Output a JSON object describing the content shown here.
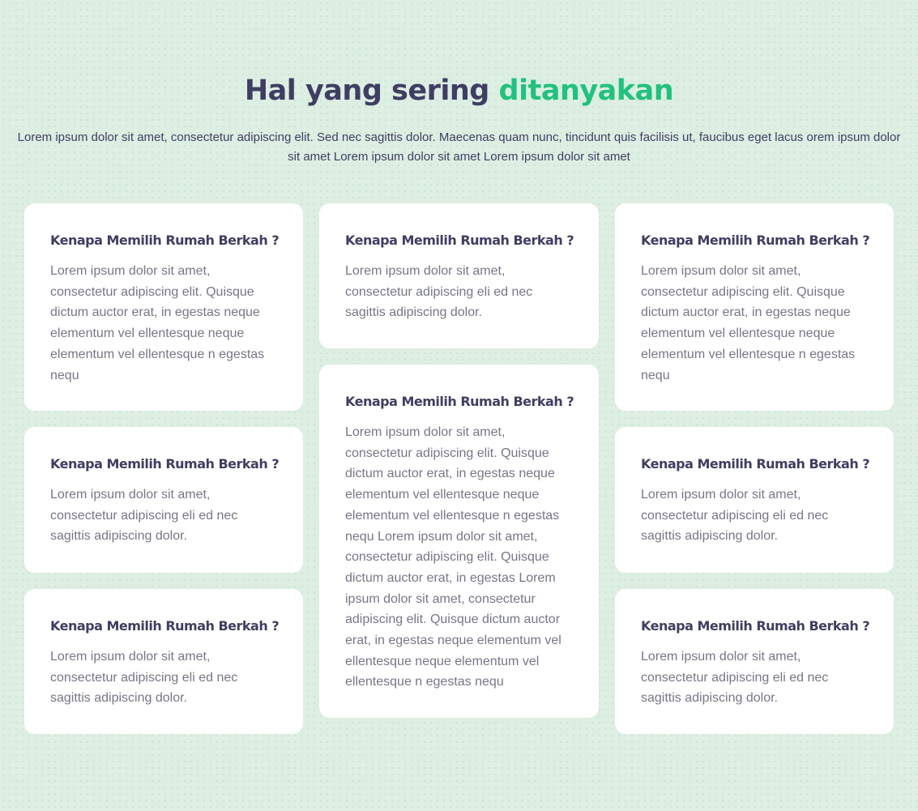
{
  "header": {
    "title_main": "Hal yang sering",
    "title_accent": "ditanyakan",
    "description": "Lorem ipsum dolor sit amet, consectetur adipiscing elit. Sed nec sagittis dolor. Maecenas quam nunc, tincidunt quis facilisis ut, faucibus eget lacus orem ipsum dolor sit amet Lorem ipsum dolor sit amet Lorem ipsum dolor sit amet"
  },
  "faq": [
    {
      "question": "Kenapa Memilih Rumah Berkah ?",
      "answer": "Lorem ipsum dolor sit amet, consectetur adipiscing elit. Quisque dictum auctor erat, in egestas neque elementum vel ellentesque neque elementum vel ellentesque n egestas nequ"
    },
    {
      "question": "Kenapa Memilih Rumah Berkah ?",
      "answer": "Lorem ipsum dolor sit amet, consectetur adipiscing eli ed nec sagittis adipiscing dolor."
    },
    {
      "question": "Kenapa Memilih Rumah Berkah ?",
      "answer": "Lorem ipsum dolor sit amet, consectetur adipiscing eli ed nec sagittis adipiscing dolor."
    },
    {
      "question": "Kenapa Memilih Rumah Berkah ?",
      "answer": "Lorem ipsum dolor sit amet, consectetur adipiscing eli ed nec sagittis adipiscing dolor."
    },
    {
      "question": "Kenapa Memilih Rumah Berkah ?",
      "answer": "Lorem ipsum dolor sit amet, consectetur adipiscing elit. Quisque dictum auctor erat, in egestas neque elementum vel ellentesque neque elementum vel ellentesque n egestas nequ Lorem ipsum dolor sit amet, consectetur adipiscing elit. Quisque dictum auctor erat, in egestas Lorem ipsum dolor sit amet, consectetur adipiscing elit. Quisque dictum auctor erat, in egestas neque elementum vel ellentesque neque elementum vel ellentesque n egestas nequ"
    },
    {
      "question": "Kenapa Memilih Rumah Berkah ?",
      "answer": "Lorem ipsum dolor sit amet, consectetur adipiscing elit. Quisque dictum auctor erat, in egestas neque elementum vel ellentesque neque elementum vel ellentesque n egestas nequ"
    },
    {
      "question": "Kenapa Memilih Rumah Berkah ?",
      "answer": "Lorem ipsum dolor sit amet, consectetur adipiscing eli ed nec sagittis adipiscing dolor."
    },
    {
      "question": "Kenapa Memilih Rumah Berkah ?",
      "answer": "Lorem ipsum dolor sit amet, consectetur adipiscing eli ed nec sagittis adipiscing dolor."
    }
  ],
  "colors": {
    "background": "#ddeee3",
    "heading": "#3f3e62",
    "accent": "#22c17e",
    "card": "#ffffff",
    "body_text": "#767787"
  }
}
